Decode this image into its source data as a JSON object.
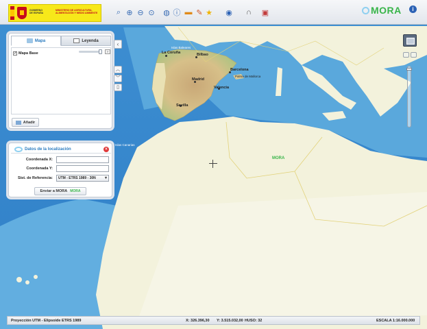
{
  "toolbar": {
    "gov_text": "GOBIERNO DE ESPAÑA",
    "ministry_text": "MINISTERIO DE AGRICULTURA, ALIMENTACIÓN Y MEDIO AMBIENTE",
    "brand": "MORA",
    "help": "i",
    "tools": [
      "zoom-window-icon",
      "zoom-in-icon",
      "zoom-out-icon",
      "zoom-full-icon",
      "globe-icon",
      "info-icon",
      "measure-line-icon",
      "pencil-icon",
      "star-icon",
      "search-place-icon",
      "magnet-icon",
      "print-icon"
    ]
  },
  "layers_panel": {
    "tab_map": "Mapa",
    "tab_legend": "Leyenda",
    "layer_checked": "✓",
    "layer_name": "Mapa Base",
    "opacity_level": 1.0,
    "add_button": "Añadir"
  },
  "location_panel": {
    "title": "Datos de la localización",
    "x_label": "Coordenada X:",
    "y_label": "Coordenada Y:",
    "srs_label": "Sist. de Referencia:",
    "x_value": "",
    "y_value": "",
    "srs_selected": "UTM - ETRS 1989 - 30N",
    "send_button": "Enviar a MORA",
    "send_button_logo": "MORA"
  },
  "map": {
    "watermark": "MORA",
    "cities": [
      "La Coruña",
      "Bilbao",
      "Barcelona",
      "Madrid",
      "Valencia",
      "Sevilla",
      "Palma de Mallorca"
    ],
    "small_labels": [
      "Islas Baleares",
      "Islas Canarias"
    ]
  },
  "statusbar": {
    "projection": "Proyección UTM - Elipsoide ETRS 1989",
    "x": "X: 326.396,30",
    "y": "Y: 3.515.032,00",
    "huso": "HUSO: 32",
    "scale": "ESCALA 1:16.000.000"
  },
  "colors": {
    "accent": "#2a7bbf",
    "brand_green": "#39b54a",
    "sea": "#5aa8dc",
    "land": "#f3f2dc"
  }
}
